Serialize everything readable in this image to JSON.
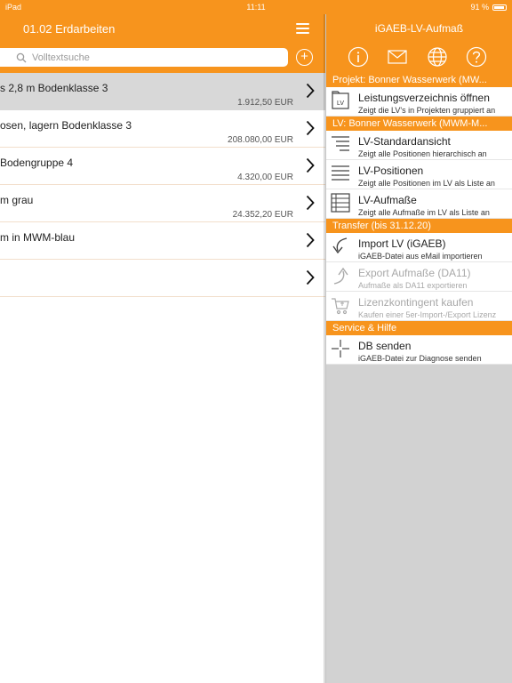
{
  "status": {
    "device": "iPad",
    "time": "11:11",
    "battery": "91 %"
  },
  "left": {
    "title": "01.02 Erdarbeiten",
    "search_placeholder": "Volltextsuche",
    "rows": [
      {
        "title": "s 2,8 m Bodenklasse 3",
        "amount": "1.912,50 EUR",
        "selected": true
      },
      {
        "title": "osen, lagern Bodenklasse 3",
        "amount": "208.080,00 EUR"
      },
      {
        "title": " Bodengruppe 4",
        "amount": "4.320,00 EUR"
      },
      {
        "title": "m grau",
        "amount": "24.352,20 EUR"
      },
      {
        "title": "m in MWM-blau",
        "amount": ""
      },
      {
        "title": "",
        "amount": ""
      }
    ]
  },
  "right": {
    "title": "iGAEB-LV-Aufmaß",
    "header_icons": [
      "info-icon",
      "mail-icon",
      "globe-icon",
      "help-icon"
    ],
    "sections": [
      {
        "title": "Projekt: Bonner Wasserwerk (MW...",
        "items": [
          {
            "icon": "lv-folder-icon",
            "title": "Leistungsverzeichnis öffnen",
            "subtitle": "Zeigt die LV's in Projekten gruppiert an",
            "disabled": false
          }
        ]
      },
      {
        "title": "LV: Bonner Wasserwerk (MWM-M...",
        "items": [
          {
            "icon": "hierarchy-list-icon",
            "title": "LV-Standardansicht",
            "subtitle": "Zeigt alle Positionen hierarchisch an",
            "disabled": false
          },
          {
            "icon": "flat-list-icon",
            "title": "LV-Positionen",
            "subtitle": "Zeigt alle Positionen im LV als Liste an",
            "disabled": false
          },
          {
            "icon": "table-icon",
            "title": "LV-Aufmaße",
            "subtitle": "Zeigt alle Aufmaße im LV als Liste an",
            "disabled": false
          }
        ]
      },
      {
        "title": "Transfer (bis 31.12.20)",
        "items": [
          {
            "icon": "import-arrow-icon",
            "title": "Import LV (iGAEB)",
            "subtitle": "iGAEB-Datei aus eMail importieren",
            "disabled": false
          },
          {
            "icon": "export-arrow-icon",
            "title": "Export Aufmaße (DA11)",
            "subtitle": "Aufmaße als DA11 exportieren",
            "disabled": true
          },
          {
            "icon": "cart-icon",
            "title": "Lizenzkontingent kaufen",
            "subtitle": "Kaufen einer 5er-Import-/Export Lizenz",
            "disabled": true
          }
        ]
      },
      {
        "title": "Service & Hilfe",
        "items": [
          {
            "icon": "database-send-icon",
            "title": "DB senden",
            "subtitle": "iGAEB-Datei zur Diagnose senden",
            "disabled": false
          }
        ]
      }
    ]
  },
  "colors": {
    "accent": "#f7941d",
    "pane_background": "#d2d2d2"
  }
}
